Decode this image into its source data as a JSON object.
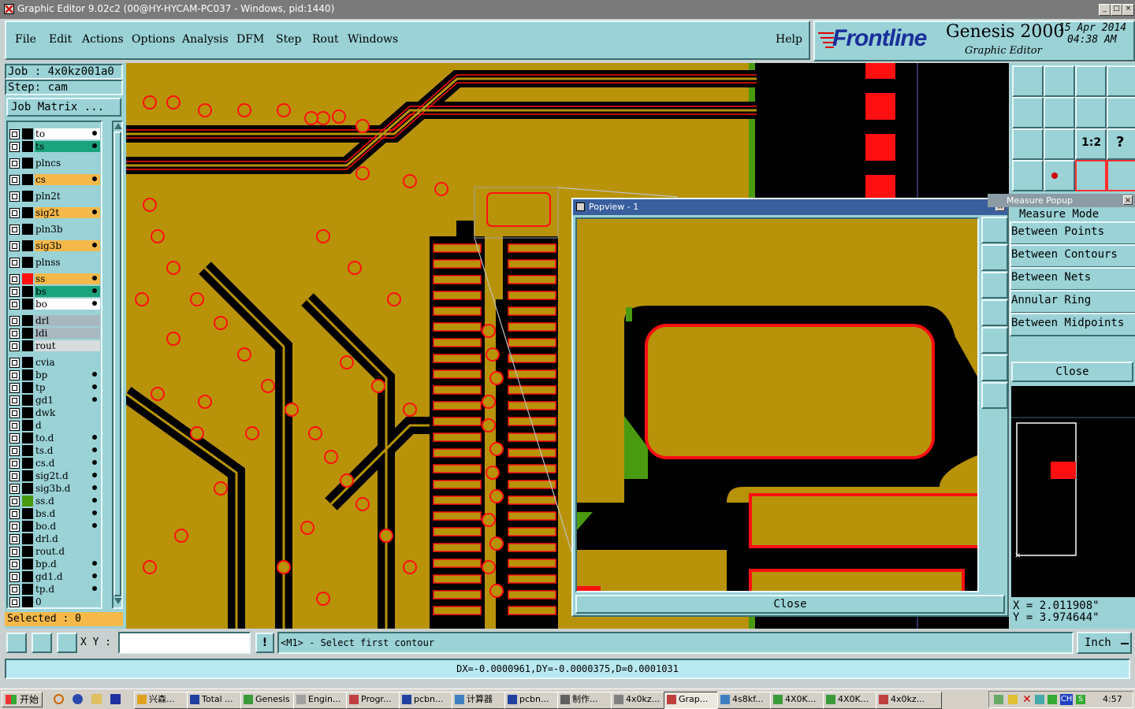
{
  "window": {
    "title": "Graphic Editor 9.02c2 (00@HY-HYCAM-PC037 - Windows, pid:1440)"
  },
  "menu": {
    "items": [
      "File",
      "Edit",
      "Actions",
      "Options",
      "Analysis",
      "DFM",
      "Step",
      "Rout",
      "Windows"
    ],
    "help": "Help"
  },
  "brand": {
    "logo": "Frontline",
    "product": "Genesis 2000",
    "subtitle": "Graphic Editor",
    "date": "15 Apr 2014",
    "time": "04:38 AM"
  },
  "job": {
    "job_label": "Job : 4x0kz001a0",
    "step_label": "Step: cam",
    "matrix_button": "Job Matrix ..."
  },
  "layers": [
    {
      "name": "to",
      "color": "#ffffff",
      "mark": true
    },
    {
      "name": "ts",
      "color": "#1aa37c",
      "mark": true
    },
    {
      "name": "plncs",
      "color": "#9ad2d6",
      "mark": false
    },
    {
      "name": "cs",
      "color": "#f5b94a",
      "mark": true
    },
    {
      "name": "pln2t",
      "color": "#9ad2d6",
      "mark": false
    },
    {
      "name": "sig2t",
      "color": "#f5b94a",
      "mark": true
    },
    {
      "name": "pln3b",
      "color": "#9ad2d6",
      "mark": false
    },
    {
      "name": "sig3b",
      "color": "#f5b94a",
      "mark": true
    },
    {
      "name": "plnss",
      "color": "#9ad2d6",
      "mark": false
    },
    {
      "name": "ss",
      "color": "#f5b94a",
      "mark": true
    },
    {
      "name": "bs",
      "color": "#1aa37c",
      "mark": true
    },
    {
      "name": "bo",
      "color": "#ffffff",
      "mark": true
    },
    {
      "name": "drl",
      "color": "#a8b8c0",
      "mark": false
    },
    {
      "name": "ldi",
      "color": "#a8b8c0",
      "mark": false
    },
    {
      "name": "rout",
      "color": "#d8dcdc",
      "mark": false
    },
    {
      "name": "cvia",
      "color": "#9ad2d6",
      "mark": false
    },
    {
      "name": "bp",
      "color": "#9ad2d6",
      "mark": true
    },
    {
      "name": "tp",
      "color": "#9ad2d6",
      "mark": true
    },
    {
      "name": "gd1",
      "color": "#9ad2d6",
      "mark": true
    },
    {
      "name": "dwk",
      "color": "#9ad2d6",
      "mark": false
    },
    {
      "name": "d",
      "color": "#9ad2d6",
      "mark": false
    },
    {
      "name": "to.d",
      "color": "#9ad2d6",
      "mark": true
    },
    {
      "name": "ts.d",
      "color": "#9ad2d6",
      "mark": true
    },
    {
      "name": "cs.d",
      "color": "#9ad2d6",
      "mark": true
    },
    {
      "name": "sig2t.d",
      "color": "#9ad2d6",
      "mark": true
    },
    {
      "name": "sig3b.d",
      "color": "#9ad2d6",
      "mark": true
    },
    {
      "name": "ss.d",
      "color": "#9ad2d6",
      "mark": true
    },
    {
      "name": "bs.d",
      "color": "#9ad2d6",
      "mark": true
    },
    {
      "name": "bo.d",
      "color": "#9ad2d6",
      "mark": true
    },
    {
      "name": "drl.d",
      "color": "#9ad2d6",
      "mark": false
    },
    {
      "name": "rout.d",
      "color": "#9ad2d6",
      "mark": false
    },
    {
      "name": "bp.d",
      "color": "#9ad2d6",
      "mark": true
    },
    {
      "name": "gd1.d",
      "color": "#9ad2d6",
      "mark": true
    },
    {
      "name": "tp.d",
      "color": "#9ad2d6",
      "mark": true
    },
    {
      "name": "0",
      "color": "#9ad2d6",
      "mark": false
    }
  ],
  "selected": "Selected : 0",
  "popview": {
    "title": "Popview - 1",
    "close": "Close"
  },
  "measure": {
    "title": "Measure Popup",
    "mode_label": "Measure Mode",
    "modes": [
      "Between Points",
      "Between Contours",
      "Between Nets",
      "Annular Ring",
      "Between Midpoints"
    ],
    "close": "Close",
    "x_readout": "X = 2.011908\"",
    "y_readout": "Y = 3.974644\""
  },
  "statusbar": {
    "xy_label": "X Y :",
    "xy_value": "",
    "message": "<M1> - Select first contour",
    "units": "Inch",
    "measure_result": "DX=-0.0000961,DY=-0.0000375,D=0.0001031"
  },
  "taskbar": {
    "start": "开始",
    "tasks": [
      "兴森...",
      "Total ...",
      "Genesis",
      "Engin...",
      "Progr...",
      "pcbn...",
      "计算器",
      "pcbn...",
      "制作...",
      "4x0kz...",
      "Grap...",
      "4s8kf...",
      "4X0K...",
      "4X0K...",
      "4x0kz..."
    ],
    "clock": "4:57",
    "ime": "CH"
  },
  "colors": {
    "copper": "#b8930a",
    "panel": "#9ad2d6",
    "highlight": "#ff1010",
    "mask": "#4a9a10"
  }
}
